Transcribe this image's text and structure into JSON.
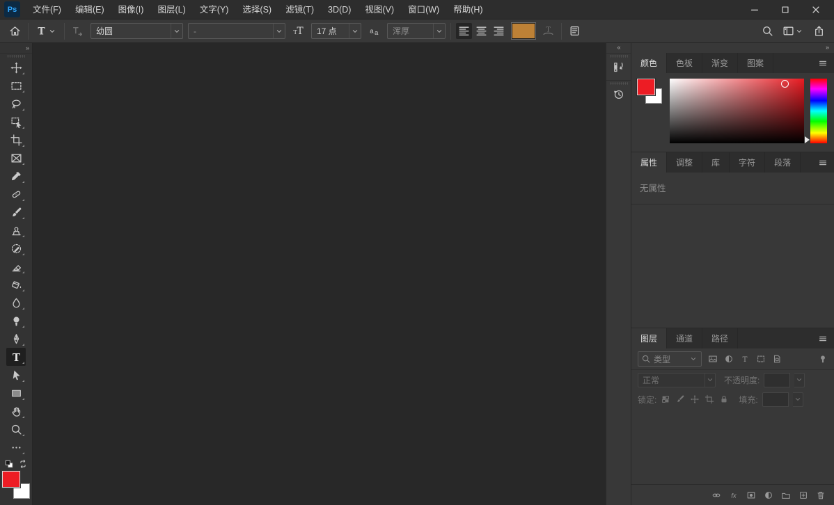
{
  "app": {
    "logo_text": "Ps"
  },
  "menu_bar": {
    "items": [
      "文件(F)",
      "编辑(E)",
      "图像(I)",
      "图层(L)",
      "文字(Y)",
      "选择(S)",
      "滤镜(T)",
      "3D(D)",
      "视图(V)",
      "窗口(W)",
      "帮助(H)"
    ]
  },
  "window_controls": {
    "buttons": [
      "minimize",
      "maximize",
      "close"
    ]
  },
  "options_bar": {
    "tool": "horizontal-type-tool",
    "font_family": {
      "value": "幼圆"
    },
    "font_style": {
      "value": "-"
    },
    "font_size": {
      "value": "17 点"
    },
    "anti_alias": {
      "value": "浑厚"
    },
    "alignment_selected": "left",
    "text_color": "#bd8136"
  },
  "toolbar": {
    "selected_tool": "type-tool",
    "tools": [
      "move-tool",
      "marquee-tool",
      "lasso-tool",
      "object-selection-tool",
      "crop-tool",
      "frame-tool",
      "eyedropper-tool",
      "spot-healing-tool",
      "brush-tool",
      "clone-stamp-tool",
      "history-brush-tool",
      "eraser-tool",
      "paint-bucket-tool",
      "blur-tool",
      "dodge-tool",
      "pen-tool",
      "type-tool",
      "path-selection-tool",
      "rectangle-tool",
      "hand-tool",
      "zoom-tool",
      "edit-toolbar"
    ],
    "foreground_color": "#ed1c24",
    "background_color": "#ffffff"
  },
  "dock": {
    "icons": [
      "layer-comps-panel-icon",
      "history-panel-icon"
    ]
  },
  "panels": {
    "color": {
      "tabs": [
        "颜色",
        "色板",
        "渐变",
        "图案"
      ],
      "active_tab": "颜色",
      "foreground_color": "#ed1c24",
      "background_color": "#ffffff"
    },
    "properties": {
      "tabs": [
        "属性",
        "调整",
        "库",
        "字符",
        "段落"
      ],
      "active_tab": "属性",
      "empty_text": "无属性"
    },
    "layers": {
      "tabs": [
        "图层",
        "通道",
        "路径"
      ],
      "active_tab": "图层",
      "filter_label": "类型",
      "blend_mode": "正常",
      "opacity_label": "不透明度:",
      "lock_label": "锁定:",
      "fill_label": "填充:"
    }
  }
}
